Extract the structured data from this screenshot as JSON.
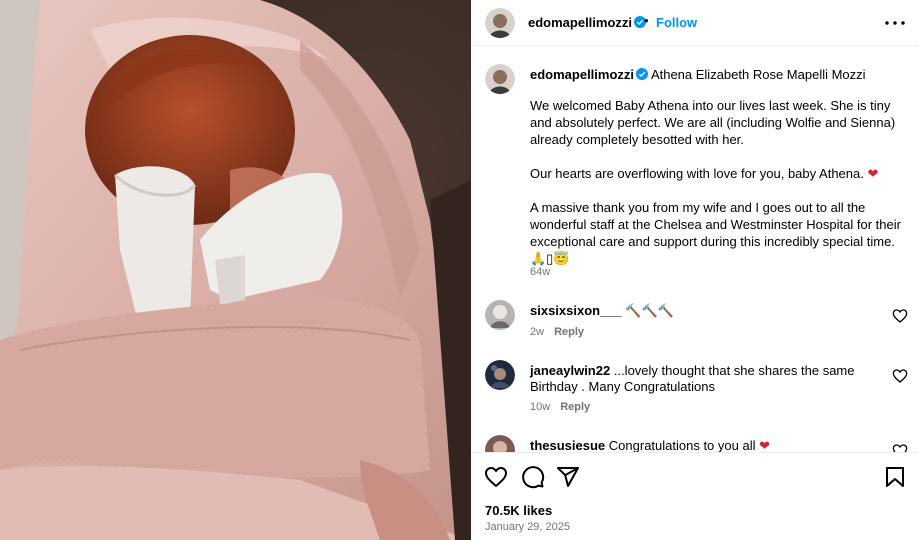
{
  "post": {
    "username": "edomapellimozzi",
    "follow_label": "Follow",
    "dot_separator": "•",
    "caption": {
      "username": "edomapellimozzi",
      "title": "Athena Elizabeth Rose Mapelli Mozzi",
      "paragraphs": [
        "We welcomed Baby Athena into our lives last week. She is tiny and absolutely perfect. We are all (including Wolfie and Sienna) already completely besotted with her.",
        "Our hearts are overflowing with love for you, baby Athena.",
        "A massive thank you from my wife and I goes out to all the wonderful staff at the Chelsea and Westminster Hospital for their exceptional care and support during this incredibly special time."
      ],
      "heart_emoji": "❤",
      "closing_emoji": "🙏▯😇",
      "time": "64w"
    },
    "likes": "70.5K likes",
    "date": "January 29, 2025"
  },
  "comments": [
    {
      "username": "sixsixsixon___",
      "text": "🔨🔨🔨",
      "time": "2w",
      "reply": "Reply"
    },
    {
      "username": "janeaylwin22",
      "text": "...lovely thought that she shares the same Birthday . Many Congratulations",
      "time": "10w",
      "reply": "Reply"
    },
    {
      "username": "thesusiesue",
      "text": "Congratulations to you all",
      "emoji": "❤"
    }
  ],
  "icons": {
    "verified": "verified-badge-icon",
    "more": "more-options-icon",
    "like": "heart-icon",
    "comment": "comment-icon",
    "share": "share-icon",
    "save": "bookmark-icon"
  },
  "colors": {
    "follow": "#0095f6",
    "verified": "#0095f6",
    "muted": "#737373",
    "heart": "#d4252b"
  }
}
